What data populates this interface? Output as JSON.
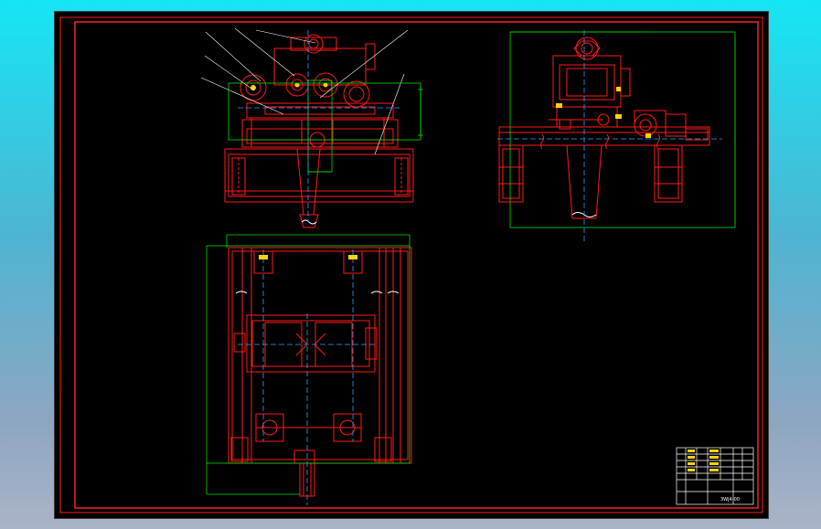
{
  "colors": {
    "background": "#000000",
    "frame": "#ff2020",
    "geometry": "#ff1a1a",
    "dimension": "#00e000",
    "center_line": "#2aa0ff",
    "accent": "#ffd400",
    "text": "#ffffff"
  },
  "title_block": {
    "drawing_no": "3WJ4-00"
  }
}
